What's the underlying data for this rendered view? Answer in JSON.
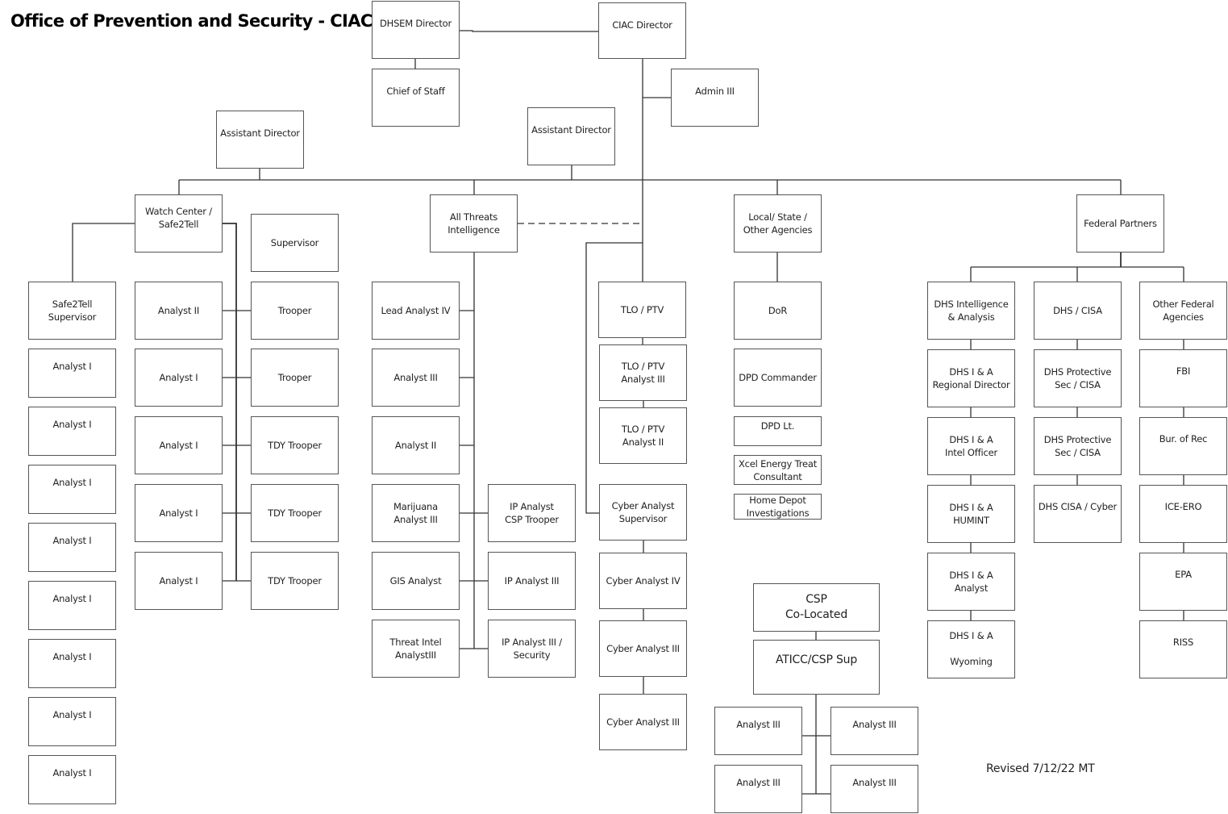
{
  "title": "Office of Prevention and Security - CIAC",
  "revised": "Revised 7/12/22 MT",
  "nodes": {
    "dhsem_director": "DHSEM Director",
    "chief_of_staff": "Chief of Staff",
    "ciac_director": "CIAC Director",
    "admin_iii": "Admin III",
    "assistant_director_left": "Assistant Director",
    "assistant_director_center": "Assistant Director",
    "watch_center": "Watch Center /\nSafe2Tell",
    "safe2tell_supervisor": "Safe2Tell\nSupervisor",
    "safe2tell_analysts": [
      "Analyst I",
      "Analyst I",
      "Analyst I",
      "Analyst I",
      "Analyst I",
      "Analyst I",
      "Analyst I",
      "Analyst I"
    ],
    "watch_analysts": [
      "Analyst II",
      "Analyst I",
      "Analyst I",
      "Analyst I",
      "Analyst I"
    ],
    "watch_supervisor": "Supervisor",
    "troopers": [
      "Trooper",
      "Trooper",
      "TDY Trooper",
      "TDY Trooper",
      "TDY Trooper"
    ],
    "all_threats": "All Threats\nIntelligence",
    "ati_left": [
      "Lead Analyst IV",
      "Analyst III",
      "Analyst II",
      "Marijuana\nAnalyst III",
      "GIS Analyst",
      "Threat Intel\nAnalystIII"
    ],
    "ati_right": [
      "IP Analyst\nCSP Trooper",
      "IP Analyst III",
      "IP Analyst III /\nSecurity"
    ],
    "tlo": [
      "TLO / PTV",
      "TLO / PTV\nAnalyst III",
      "TLO / PTV\nAnalyst II"
    ],
    "cyber": [
      "Cyber Analyst\nSupervisor",
      "Cyber Analyst IV",
      "Cyber Analyst III",
      "Cyber Analyst III"
    ],
    "local_state": "Local/ State /\nOther Agencies",
    "local_items": [
      "DoR",
      "DPD Commander",
      "DPD Lt.",
      "Xcel Energy Treat\nConsultant",
      "Home Depot\nInvestigations"
    ],
    "csp_colocated": "CSP\nCo-Located",
    "aticc_sup": "ATICC/CSP Sup",
    "csp_analysts": [
      "Analyst III",
      "Analyst III",
      "Analyst III",
      "Analyst III"
    ],
    "federal_partners": "Federal Partners",
    "dhs_ia": [
      "DHS Intelligence\n& Analysis",
      "DHS I & A\nRegional Director",
      "DHS I & A\nIntel Officer",
      "DHS I & A\nHUMINT",
      "DHS I & A\nAnalyst",
      "DHS I & A\n\nWyoming"
    ],
    "dhs_cisa": [
      "DHS / CISA",
      "DHS Protective\nSec / CISA",
      "DHS Protective\nSec / CISA",
      "DHS CISA / Cyber"
    ],
    "other_federal": [
      "Other Federal\nAgencies",
      "FBI",
      "Bur. of Rec",
      "ICE-ERO",
      "EPA",
      "RISS"
    ]
  }
}
